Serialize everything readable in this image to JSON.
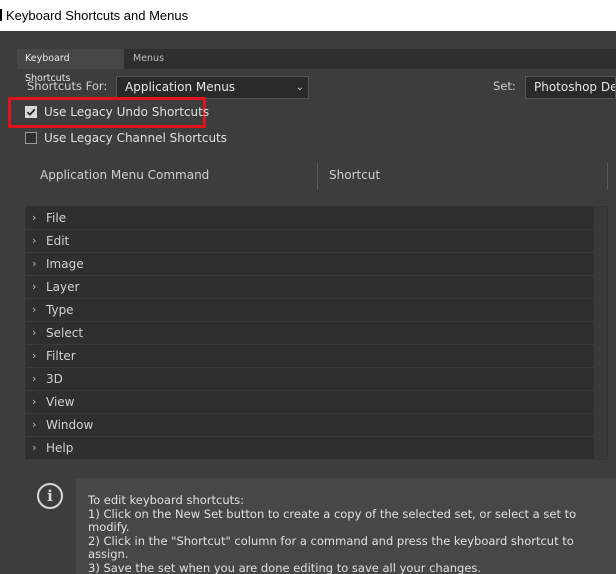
{
  "window": {
    "title": "Keyboard Shortcuts and Menus"
  },
  "tabs": [
    {
      "label": "Keyboard Shortcuts",
      "active": true
    },
    {
      "label": "Menus",
      "active": false
    }
  ],
  "shortcuts_for": {
    "label": "Shortcuts For:",
    "value": "Application Menus"
  },
  "set": {
    "label": "Set:",
    "value": "Photoshop Defaults"
  },
  "checkboxes": [
    {
      "label": "Use Legacy Undo Shortcuts",
      "checked": true
    },
    {
      "label": "Use Legacy Channel Shortcuts",
      "checked": false
    }
  ],
  "table": {
    "columns": [
      "Application Menu Command",
      "Shortcut"
    ],
    "rows": [
      "File",
      "Edit",
      "Image",
      "Layer",
      "Type",
      "Select",
      "Filter",
      "3D",
      "View",
      "Window",
      "Help"
    ]
  },
  "info": {
    "lines": [
      "To edit keyboard shortcuts:",
      "1) Click on the New Set button to create a copy of the selected set, or select a set to modify.",
      "2) Click in the \"Shortcut\" column for a command and press the keyboard shortcut to assign.",
      "3) Save the set when you are done editing to save all your changes."
    ]
  },
  "colors": {
    "highlight": "#e0121c",
    "dialog_bg": "#3d3d3d",
    "panel_bg": "#2f2f2f"
  },
  "icons": [
    "chevron-down-icon",
    "chevron-right-icon",
    "checkmark-icon",
    "info-icon"
  ]
}
